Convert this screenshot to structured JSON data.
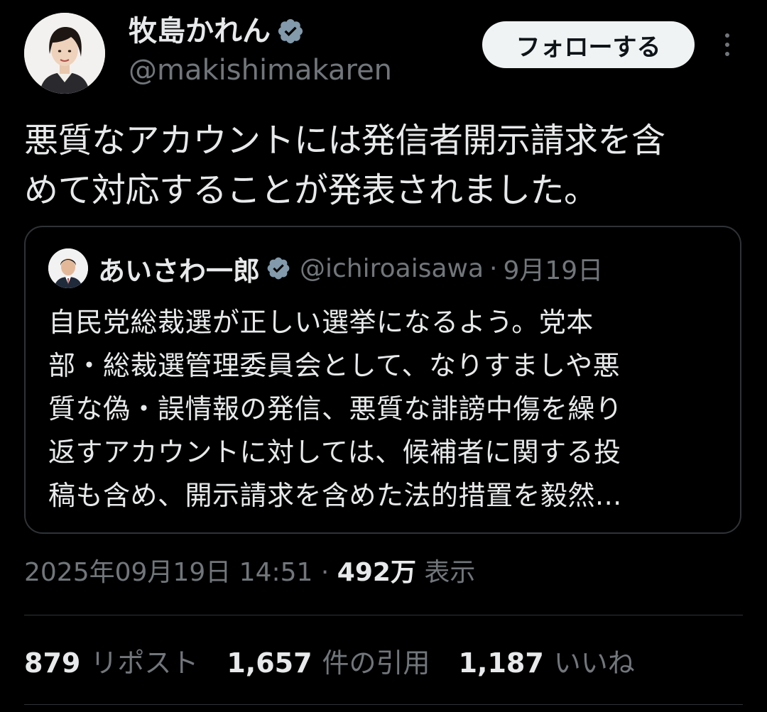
{
  "colors": {
    "background": "#000000",
    "text_primary": "#e7e9ea",
    "text_secondary": "#71767b",
    "border": "#2f3336",
    "verified_badge": "#829aab",
    "follow_button_bg": "#eff3f4"
  },
  "author": {
    "display_name": "牧島かれん",
    "handle": "@makishimakaren",
    "verified_icon": "verified-badge-icon"
  },
  "follow_button": {
    "label": "フォローする"
  },
  "more_icon": "more-options-icon",
  "tweet": {
    "lines": [
      "悪質なアカウントには発信者開示請求を含",
      "めて対応することが発表されました。"
    ]
  },
  "quoted": {
    "display_name": "あいさわ一郎",
    "handle": "@ichiroaisawa",
    "separator": "·",
    "date": "9月19日",
    "lines": [
      "自民党総裁選が正しい選挙になるよう。党本",
      "部・総裁選管理委員会として、なりすましや悪",
      "質な偽・誤情報の発信、悪質な誹謗中傷を繰り",
      "返すアカウントに対しては、候補者に関する投",
      "稿も含め、開示請求を含めた法的措置を毅然..."
    ]
  },
  "meta": {
    "timestamp": "2025年09月19日 14:51",
    "separator": "·",
    "views_count": "492万",
    "views_label": "表示"
  },
  "stats": {
    "reposts_count": "879",
    "reposts_label": "リポスト",
    "quotes_count": "1,657",
    "quotes_label": "件の引用",
    "likes_count": "1,187",
    "likes_label": "いいね"
  }
}
